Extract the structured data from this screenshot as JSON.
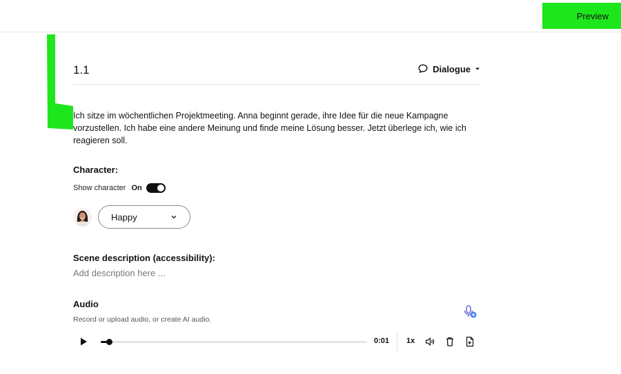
{
  "topbar": {
    "preview_label": "Preview"
  },
  "slide": {
    "number": "1.1",
    "type_label": "Dialogue",
    "scene_text": "Ich sitze im wöchentlichen Projektmeeting. Anna beginnt gerade, ihre Idee für die neue Kampagne vorzustellen. Ich habe eine andere Meinung und finde meine Lösung besser. Jetzt überlege ich, wie ich reagieren soll."
  },
  "character": {
    "heading": "Character:",
    "show_label": "Show character",
    "toggle_state": "On",
    "emotion": "Happy"
  },
  "scene_description": {
    "heading": "Scene description (accessibility):",
    "placeholder": "Add description here ..."
  },
  "audio": {
    "heading": "Audio",
    "hint": "Record or upload audio, or create AI audio.",
    "time": "0:01",
    "speed": "1x",
    "progress": 0.03
  },
  "colors": {
    "preview_bg": "#1ee61c",
    "mic_icon": "#6b6bd6",
    "mic_badge": "#4a7ff0"
  }
}
